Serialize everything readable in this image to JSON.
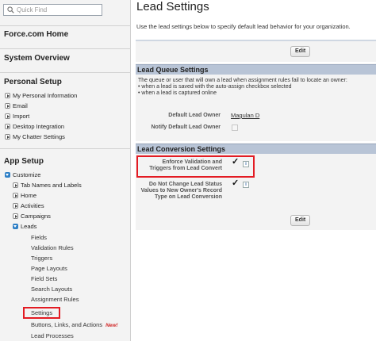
{
  "search": {
    "placeholder": "Quick Find"
  },
  "sidebar": {
    "force_home": "Force.com Home",
    "system_overview": "System Overview",
    "personal_setup": {
      "title": "Personal Setup",
      "items": [
        "My Personal Information",
        "Email",
        "Import",
        "Desktop Integration",
        "My Chatter Settings"
      ]
    },
    "app_setup": {
      "title": "App Setup",
      "customize": "Customize",
      "customize_items": [
        "Tab Names and Labels",
        "Home",
        "Activities",
        "Campaigns"
      ],
      "leads": "Leads",
      "lead_items": [
        "Fields",
        "Validation Rules",
        "Triggers",
        "Page Layouts",
        "Field Sets",
        "Search Layouts",
        "Assignment Rules",
        "Settings",
        "Buttons, Links, and Actions",
        "Lead Processes"
      ],
      "new_badge": "New!"
    }
  },
  "main": {
    "title": "Lead Settings",
    "description": "Use the lead settings below to specify default lead behavior for your organization.",
    "edit_label": "Edit",
    "queue": {
      "title": "Lead Queue Settings",
      "info_lines": [
        "The queue or user that will own a lead when assignment rules fail to locate an owner:",
        "• when a lead is saved with the auto-assign checkbox selected",
        "• when a lead is captured online"
      ],
      "default_owner_label": "Default Lead Owner",
      "default_owner_value": "Magulan D",
      "notify_label": "Notify Default Lead Owner"
    },
    "conversion": {
      "title": "Lead Conversion Settings",
      "enforce_label": "Enforce Validation and Triggers from Lead Convert",
      "dont_change_label": "Do Not Change Lead Status Values to New Owner's Record Type on Lead Conversion"
    }
  },
  "colors": {
    "highlight": "#e31b23",
    "section_bar": "#b8c4d6",
    "expand_icon": "#2d7fc6"
  }
}
